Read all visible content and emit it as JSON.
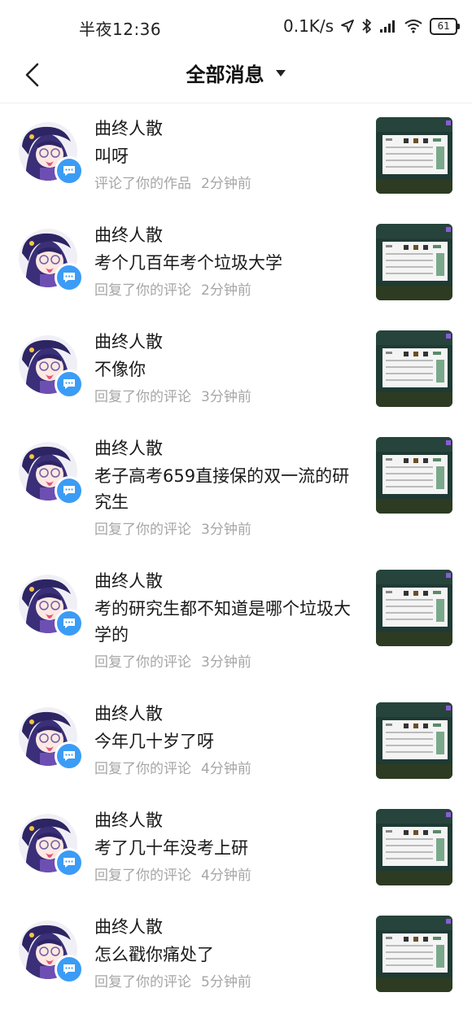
{
  "status_bar": {
    "time": "半夜12:36",
    "network_speed": "0.1K/s",
    "battery": "61",
    "icons": [
      "location-icon",
      "bluetooth-icon",
      "signal-icon",
      "wifi-icon",
      "battery-icon"
    ]
  },
  "nav": {
    "title": "全部消息"
  },
  "messages": [
    {
      "user": "曲终人散",
      "content": "叫呀",
      "action": "评论了你的作品",
      "time": "2分钟前"
    },
    {
      "user": "曲终人散",
      "content": "考个几百年考个垃圾大学",
      "action": "回复了你的评论",
      "time": "2分钟前"
    },
    {
      "user": "曲终人散",
      "content": "不像你",
      "action": "回复了你的评论",
      "time": "3分钟前"
    },
    {
      "user": "曲终人散",
      "content": "老子高考659直接保的双一流的研究生",
      "action": "回复了你的评论",
      "time": "3分钟前"
    },
    {
      "user": "曲终人散",
      "content": "考的研究生都不知道是哪个垃圾大学的",
      "action": "回复了你的评论",
      "time": "3分钟前"
    },
    {
      "user": "曲终人散",
      "content": "今年几十岁了呀",
      "action": "回复了你的评论",
      "time": "4分钟前"
    },
    {
      "user": "曲终人散",
      "content": "考了几十年没考上研",
      "action": "回复了你的评论",
      "time": "4分钟前"
    },
    {
      "user": "曲终人散",
      "content": "怎么戳你痛处了",
      "action": "回复了你的评论",
      "time": "5分钟前"
    }
  ]
}
